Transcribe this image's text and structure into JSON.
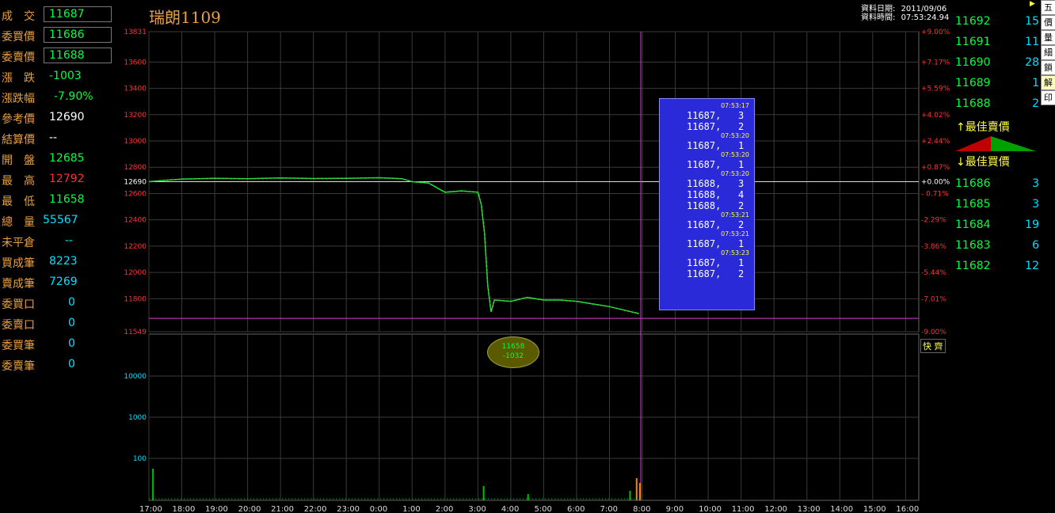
{
  "quote_panel": [
    {
      "label": "成　交",
      "value": "11687",
      "color": "#00ff40",
      "boxed": true
    },
    {
      "label": "委買價",
      "value": "11686",
      "color": "#00ff40",
      "boxed": true
    },
    {
      "label": "委賣價",
      "value": "11688",
      "color": "#00ff40",
      "boxed": true
    },
    {
      "label": "漲　跌",
      "value": "-1003",
      "color": "#00ff40",
      "boxed": false
    },
    {
      "label": "漲跌幅",
      "value": "-7.90%",
      "color": "#00ff40",
      "boxed": false
    },
    {
      "label": "參考價",
      "value": "12690",
      "color": "#ffffff",
      "boxed": false
    },
    {
      "label": "結算價",
      "value": "--",
      "color": "#ffffff",
      "boxed": false
    },
    {
      "label": "開　盤",
      "value": "12685",
      "color": "#00ff40",
      "boxed": false
    },
    {
      "label": "最　高",
      "value": "12792",
      "color": "#ff3030",
      "boxed": false
    },
    {
      "label": "最　低",
      "value": "11658",
      "color": "#00ff40",
      "boxed": false
    },
    {
      "label": "總　量",
      "value": "55567",
      "color": "#00e0ff",
      "boxed": false
    },
    {
      "label": "未平倉",
      "value": "--",
      "color": "#00e0ff",
      "boxed": false
    },
    {
      "label": "買成筆",
      "value": "8223",
      "color": "#00e0ff",
      "boxed": false
    },
    {
      "label": "賣成筆",
      "value": "7269",
      "color": "#00e0ff",
      "boxed": false
    },
    {
      "label": "委買口",
      "value": "0",
      "color": "#00e0ff",
      "boxed": false
    },
    {
      "label": "委賣口",
      "value": "0",
      "color": "#00e0ff",
      "boxed": false
    },
    {
      "label": "委買筆",
      "value": "0",
      "color": "#00e0ff",
      "boxed": false
    },
    {
      "label": "委賣筆",
      "value": "0",
      "color": "#00e0ff",
      "boxed": false
    }
  ],
  "header": {
    "title": "瑞朗1109",
    "date_label": "資料日期:",
    "date_value": "2011/09/06",
    "time_label": "資料時間:",
    "time_value": "07:53:24.94"
  },
  "order_book": {
    "asks": [
      {
        "price": "11692",
        "vol": "15"
      },
      {
        "price": "11691",
        "vol": "11"
      },
      {
        "price": "11690",
        "vol": "28"
      },
      {
        "price": "11689",
        "vol": "1"
      },
      {
        "price": "11688",
        "vol": "2"
      }
    ],
    "best_ask_label": "↑最佳賣價",
    "best_bid_label": "↓最佳買價",
    "bids": [
      {
        "price": "11686",
        "vol": "3"
      },
      {
        "price": "11685",
        "vol": "3"
      },
      {
        "price": "11684",
        "vol": "19"
      },
      {
        "price": "11683",
        "vol": "6"
      },
      {
        "price": "11682",
        "vol": "12"
      }
    ]
  },
  "side_buttons": [
    "五",
    "價",
    "量",
    "細",
    "鎖",
    "解",
    "印"
  ],
  "tick_popup": [
    {
      "time": "07:53:17",
      "entries": [
        "11687,   3",
        "11687,   2"
      ]
    },
    {
      "time": "07:53:20",
      "entries": [
        "11687,   1"
      ]
    },
    {
      "time": "07:53:20",
      "entries": [
        "11687,   1"
      ]
    },
    {
      "time": "07:53:20",
      "entries": [
        "11688,   3",
        "11688,   4",
        "11688,   2"
      ]
    },
    {
      "time": "07:53:21",
      "entries": [
        "11687,   2"
      ]
    },
    {
      "time": "07:53:21",
      "entries": [
        "11687,   1"
      ]
    },
    {
      "time": "07:53:23",
      "entries": [
        "11687,   1",
        "11687,   2"
      ]
    }
  ],
  "low_marker": {
    "price": "11658",
    "change": "-1032"
  },
  "speed_button": "快",
  "slow_button": "齊",
  "chart_data": {
    "type": "line",
    "y_left_ticks": [
      "13831",
      "13600",
      "13400",
      "13200",
      "13000",
      "12800",
      "12690",
      "12600",
      "12400",
      "12200",
      "12000",
      "11800",
      "11549"
    ],
    "y_right_ticks": [
      "+9.00%",
      "+7.17%",
      "+5.59%",
      "+4.02%",
      "+2.44%",
      "+0.87%",
      "+0.00%",
      "- 0.71%",
      "-2.29%",
      "-3.86%",
      "-5.44%",
      "-7.01%",
      "-9.00%"
    ],
    "x_labels": [
      "17:00",
      "18:00",
      "19:00",
      "20:00",
      "21:00",
      "22:00",
      "23:00",
      "0:00",
      "1:00",
      "2:00",
      "3:00",
      "4:00",
      "5:00",
      "6:00",
      "7:00",
      "8:00",
      "9:00",
      "10:00",
      "11:00",
      "12:00",
      "13:00",
      "14:00",
      "15:00",
      "16:00"
    ],
    "volume_ticks": [
      "10000",
      "1000",
      "100"
    ],
    "reference_price": 12690,
    "ylim": [
      11549,
      13831
    ],
    "price_points": [
      [
        0,
        12690
      ],
      [
        0.5,
        12700
      ],
      [
        1,
        12710
      ],
      [
        2,
        12715
      ],
      [
        3,
        12712
      ],
      [
        4,
        12718
      ],
      [
        5,
        12714
      ],
      [
        6,
        12716
      ],
      [
        7,
        12720
      ],
      [
        7.7,
        12712
      ],
      [
        8,
        12690
      ],
      [
        8.5,
        12680
      ],
      [
        9,
        12610
      ],
      [
        9.5,
        12620
      ],
      [
        10,
        12610
      ],
      [
        10.1,
        12520
      ],
      [
        10.2,
        12300
      ],
      [
        10.3,
        11900
      ],
      [
        10.4,
        11700
      ],
      [
        10.5,
        11790
      ],
      [
        11,
        11780
      ],
      [
        11.5,
        11810
      ],
      [
        12,
        11790
      ],
      [
        12.5,
        11790
      ],
      [
        13,
        11780
      ],
      [
        13.5,
        11760
      ],
      [
        14,
        11740
      ],
      [
        14.5,
        11710
      ],
      [
        14.9,
        11687
      ]
    ],
    "current_price": 11687,
    "low_price": 11658,
    "low_change": -1032
  }
}
